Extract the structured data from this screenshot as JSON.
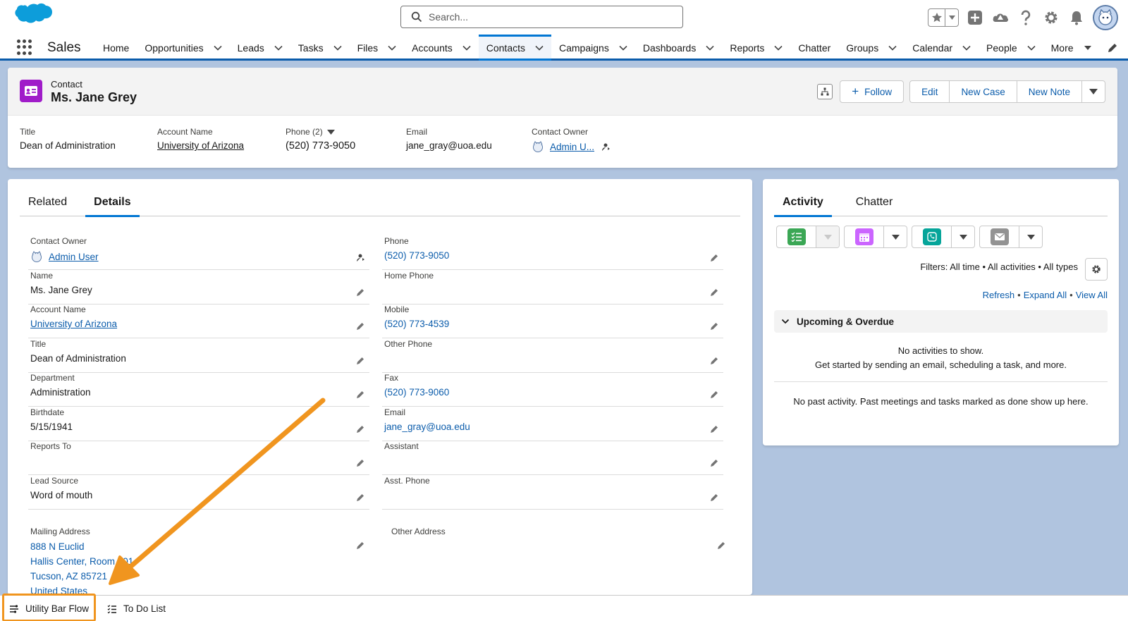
{
  "header": {
    "search_placeholder": "Search..."
  },
  "nav": {
    "app_name": "Sales",
    "items": [
      {
        "label": "Home",
        "has_menu": false
      },
      {
        "label": "Opportunities",
        "has_menu": true
      },
      {
        "label": "Leads",
        "has_menu": true
      },
      {
        "label": "Tasks",
        "has_menu": true
      },
      {
        "label": "Files",
        "has_menu": true
      },
      {
        "label": "Accounts",
        "has_menu": true
      },
      {
        "label": "Contacts",
        "has_menu": true,
        "active": true
      },
      {
        "label": "Campaigns",
        "has_menu": true
      },
      {
        "label": "Dashboards",
        "has_menu": true
      },
      {
        "label": "Reports",
        "has_menu": true
      },
      {
        "label": "Chatter",
        "has_menu": false
      },
      {
        "label": "Groups",
        "has_menu": true
      },
      {
        "label": "Calendar",
        "has_menu": true
      },
      {
        "label": "People",
        "has_menu": true
      },
      {
        "label": "More",
        "has_menu": true
      }
    ]
  },
  "record": {
    "type_label": "Contact",
    "name": "Ms. Jane Grey",
    "actions": {
      "follow": "Follow",
      "edit": "Edit",
      "new_case": "New Case",
      "new_note": "New Note"
    },
    "highlights": {
      "title_label": "Title",
      "title_value": "Dean of Administration",
      "account_label": "Account Name",
      "account_value": "University of Arizona",
      "phone_label": "Phone (2)",
      "phone_value": "(520) 773-9050",
      "email_label": "Email",
      "email_value": "jane_gray@uoa.edu",
      "owner_label": "Contact Owner",
      "owner_value": "Admin U..."
    }
  },
  "details": {
    "tabs": [
      "Related",
      "Details"
    ],
    "active_tab": "Details",
    "left_fields": [
      {
        "label": "Contact Owner",
        "value": "Admin User",
        "link": true
      },
      {
        "label": "Name",
        "value": "Ms. Jane Grey"
      },
      {
        "label": "Account Name",
        "value": "University of Arizona",
        "link": true
      },
      {
        "label": "Title",
        "value": "Dean of Administration"
      },
      {
        "label": "Department",
        "value": "Administration"
      },
      {
        "label": "Birthdate",
        "value": "5/15/1941"
      },
      {
        "label": "Reports To",
        "value": ""
      },
      {
        "label": "Lead Source",
        "value": "Word of mouth"
      }
    ],
    "right_fields": [
      {
        "label": "Phone",
        "value": "(520) 773-9050",
        "link": true
      },
      {
        "label": "Home Phone",
        "value": ""
      },
      {
        "label": "Mobile",
        "value": "(520) 773-4539",
        "link": true
      },
      {
        "label": "Other Phone",
        "value": ""
      },
      {
        "label": "Fax",
        "value": "(520) 773-9060",
        "link": true
      },
      {
        "label": "Email",
        "value": "jane_gray@uoa.edu",
        "link": true
      },
      {
        "label": "Assistant",
        "value": ""
      },
      {
        "label": "Asst. Phone",
        "value": ""
      }
    ],
    "mailing_address": {
      "label": "Mailing Address",
      "line1": "888 N Euclid",
      "line2": "Hallis Center, Room 501",
      "line3": "Tucson, AZ 85721",
      "line4": "United States"
    },
    "other_address_label": "Other Address"
  },
  "activity": {
    "tabs": [
      "Activity",
      "Chatter"
    ],
    "active_tab": "Activity",
    "filters_text": "Filters: All time • All activities • All types",
    "links": {
      "refresh": "Refresh",
      "expand_all": "Expand All",
      "view_all": "View All"
    },
    "upcoming_label": "Upcoming & Overdue",
    "empty_line1": "No activities to show.",
    "empty_line2": "Get started by sending an email, scheduling a task, and more.",
    "past_text": "No past activity. Past meetings and tasks marked as done show up here."
  },
  "utility_bar": {
    "items": [
      {
        "label": "Utility Bar Flow",
        "icon": "flow-icon"
      },
      {
        "label": "To Do List",
        "icon": "list-icon"
      }
    ]
  },
  "colors": {
    "brand_blue": "#0176d3",
    "link_blue": "#0b5cab",
    "contact_icon": "#a01cc9",
    "highlight_orange": "#f0951f",
    "page_bg": "#b0c4df"
  }
}
